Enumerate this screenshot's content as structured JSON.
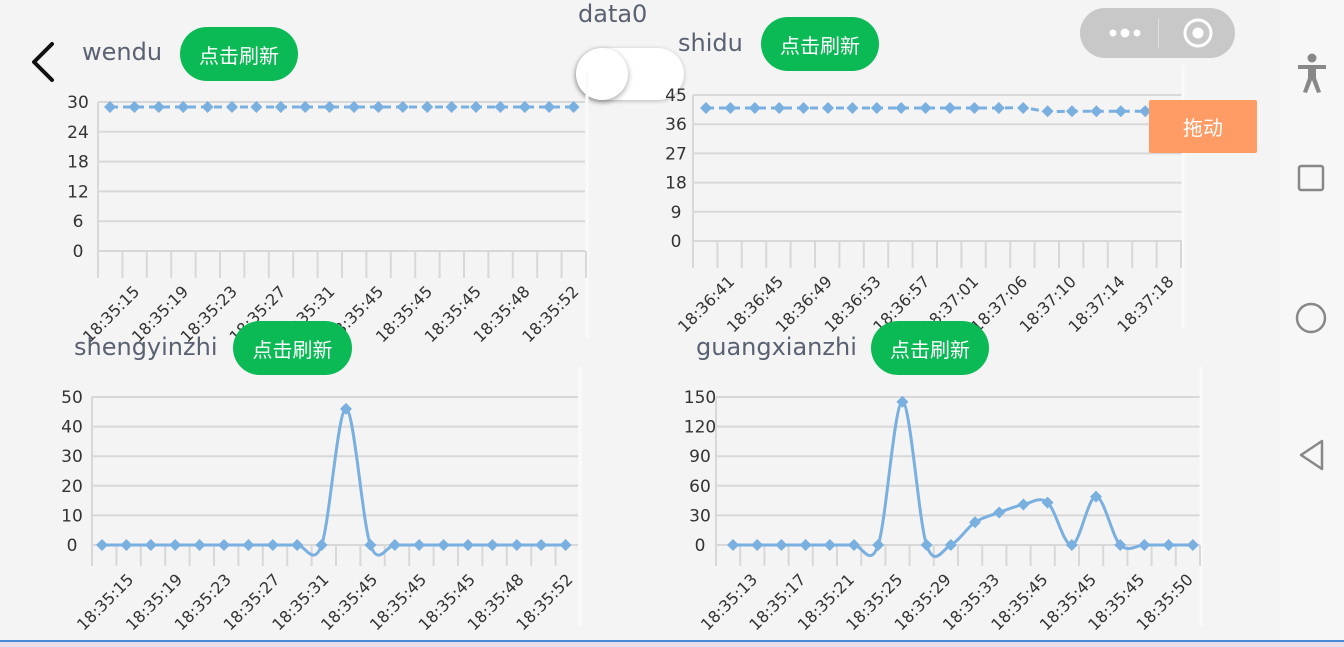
{
  "toggle": {
    "label": "data0",
    "on": false
  },
  "drag_button": {
    "label": "拖动"
  },
  "refresh_label": "点击刷新",
  "colors": {
    "line": "#7ab0e0",
    "grid": "#d8d8d8",
    "button": "#0bb955",
    "drag": "#ff9b64"
  },
  "charts": [
    {
      "title": "wendu",
      "button": "点击刷新",
      "yticks": [
        "30",
        "24",
        "18",
        "12",
        "6",
        "0"
      ],
      "ymax": 30,
      "xlabels": [
        "18:35:15",
        "18:35:19",
        "18:35:23",
        "18:35:27",
        "18:35:31",
        "18:35:45",
        "18:35:45",
        "18:35:45",
        "18:35:48",
        "18:35:52"
      ],
      "values": [
        29,
        29,
        29,
        29,
        29,
        29,
        29,
        29,
        29,
        29,
        29,
        29,
        29,
        29,
        29,
        29,
        29,
        29,
        29,
        29
      ],
      "dashed": true
    },
    {
      "title": "shidu",
      "button": "点击刷新",
      "yticks": [
        "45",
        "36",
        "27",
        "18",
        "9",
        "0"
      ],
      "ymax": 45,
      "xlabels": [
        "18:36:41",
        "18:36:45",
        "18:36:49",
        "18:36:53",
        "18:36:57",
        "18:37:01",
        "18:37:06",
        "18:37:10",
        "18:37:14",
        "18:37:18"
      ],
      "values": [
        41,
        41,
        41,
        41,
        41,
        41,
        41,
        41,
        41,
        41,
        41,
        41,
        41,
        41,
        40,
        40,
        40,
        40,
        40,
        40,
        40,
        40
      ],
      "dashed": true
    },
    {
      "title": "shengyinzhi",
      "button": "点击刷新",
      "yticks": [
        "50",
        "40",
        "30",
        "20",
        "10",
        "0"
      ],
      "ymax": 50,
      "xlabels": [
        "18:35:15",
        "18:35:19",
        "18:35:23",
        "18:35:27",
        "18:35:31",
        "18:35:45",
        "18:35:45",
        "18:35:45",
        "18:35:48",
        "18:35:52"
      ],
      "values": [
        0,
        0,
        0,
        0,
        0,
        0,
        0,
        0,
        0,
        0,
        46,
        0,
        0,
        0,
        0,
        0,
        0,
        0,
        0,
        0
      ],
      "dashed": false
    },
    {
      "title": "guangxianzhi",
      "button": "点击刷新",
      "yticks": [
        "150",
        "120",
        "90",
        "60",
        "30",
        "0"
      ],
      "ymax": 150,
      "xlabels": [
        "18:35:13",
        "18:35:17",
        "18:35:21",
        "18:35:25",
        "18:35:29",
        "18:35:33",
        "18:35:45",
        "18:35:45",
        "18:35:45",
        "18:35:50"
      ],
      "values": [
        0,
        0,
        0,
        0,
        0,
        0,
        0,
        145,
        0,
        0,
        23,
        33,
        41,
        43,
        0,
        49,
        0,
        0,
        0,
        0
      ],
      "dashed": false
    }
  ],
  "chart_data": [
    {
      "type": "line",
      "title": "wendu",
      "x": [
        "18:35:15",
        "18:35:19",
        "18:35:23",
        "18:35:27",
        "18:35:31",
        "18:35:45",
        "18:35:45",
        "18:35:45",
        "18:35:48",
        "18:35:52"
      ],
      "series": [
        {
          "values": [
            29,
            29,
            29,
            29,
            29,
            29,
            29,
            29,
            29,
            29,
            29,
            29,
            29,
            29,
            29,
            29,
            29,
            29,
            29,
            29
          ]
        }
      ],
      "ylim": [
        0,
        30
      ]
    },
    {
      "type": "line",
      "title": "shidu",
      "x": [
        "18:36:41",
        "18:36:45",
        "18:36:49",
        "18:36:53",
        "18:36:57",
        "18:37:01",
        "18:37:06",
        "18:37:10",
        "18:37:14",
        "18:37:18"
      ],
      "series": [
        {
          "values": [
            41,
            41,
            41,
            41,
            41,
            41,
            41,
            41,
            41,
            41,
            41,
            41,
            41,
            41,
            40,
            40,
            40,
            40,
            40,
            40,
            40,
            40
          ]
        }
      ],
      "ylim": [
        0,
        45
      ]
    },
    {
      "type": "line",
      "title": "shengyinzhi",
      "x": [
        "18:35:15",
        "18:35:19",
        "18:35:23",
        "18:35:27",
        "18:35:31",
        "18:35:45",
        "18:35:45",
        "18:35:45",
        "18:35:48",
        "18:35:52"
      ],
      "series": [
        {
          "values": [
            0,
            0,
            0,
            0,
            0,
            0,
            0,
            0,
            0,
            0,
            46,
            0,
            0,
            0,
            0,
            0,
            0,
            0,
            0,
            0
          ]
        }
      ],
      "ylim": [
        0,
        50
      ]
    },
    {
      "type": "line",
      "title": "guangxianzhi",
      "x": [
        "18:35:13",
        "18:35:17",
        "18:35:21",
        "18:35:25",
        "18:35:29",
        "18:35:33",
        "18:35:45",
        "18:35:45",
        "18:35:45",
        "18:35:50"
      ],
      "series": [
        {
          "values": [
            0,
            0,
            0,
            0,
            0,
            0,
            0,
            145,
            0,
            0,
            23,
            33,
            41,
            43,
            0,
            49,
            0,
            0,
            0,
            0
          ]
        }
      ],
      "ylim": [
        0,
        150
      ]
    }
  ]
}
